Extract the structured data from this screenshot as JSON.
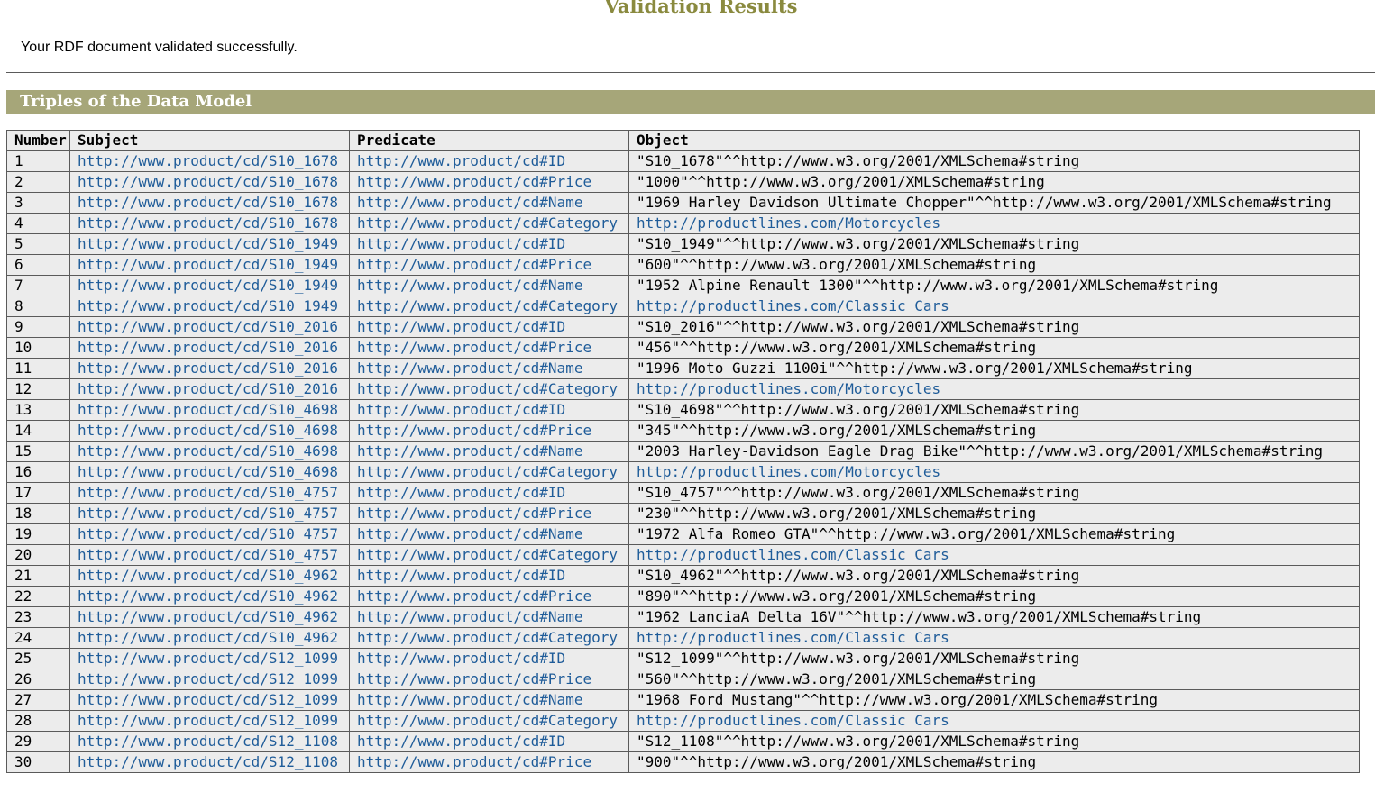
{
  "page": {
    "title": "Validation Results",
    "status_message": "Your RDF document validated successfully."
  },
  "section": {
    "title": "Triples of the Data Model"
  },
  "table": {
    "headers": {
      "number": "Number",
      "subject": "Subject",
      "predicate": "Predicate",
      "object": "Object"
    },
    "rows": [
      {
        "number": "1",
        "subject": "http://www.product/cd/S10_1678",
        "predicate": "http://www.product/cd#ID",
        "object": "\"S10_1678\"^^http://www.w3.org/2001/XMLSchema#string",
        "object_is_link": false
      },
      {
        "number": "2",
        "subject": "http://www.product/cd/S10_1678",
        "predicate": "http://www.product/cd#Price",
        "object": "\"1000\"^^http://www.w3.org/2001/XMLSchema#string",
        "object_is_link": false
      },
      {
        "number": "3",
        "subject": "http://www.product/cd/S10_1678",
        "predicate": "http://www.product/cd#Name",
        "object": "\"1969 Harley Davidson Ultimate Chopper\"^^http://www.w3.org/2001/XMLSchema#string",
        "object_is_link": false
      },
      {
        "number": "4",
        "subject": "http://www.product/cd/S10_1678",
        "predicate": "http://www.product/cd#Category",
        "object": "http://productlines.com/Motorcycles",
        "object_is_link": true
      },
      {
        "number": "5",
        "subject": "http://www.product/cd/S10_1949",
        "predicate": "http://www.product/cd#ID",
        "object": "\"S10_1949\"^^http://www.w3.org/2001/XMLSchema#string",
        "object_is_link": false
      },
      {
        "number": "6",
        "subject": "http://www.product/cd/S10_1949",
        "predicate": "http://www.product/cd#Price",
        "object": "\"600\"^^http://www.w3.org/2001/XMLSchema#string",
        "object_is_link": false
      },
      {
        "number": "7",
        "subject": "http://www.product/cd/S10_1949",
        "predicate": "http://www.product/cd#Name",
        "object": "\"1952 Alpine Renault 1300\"^^http://www.w3.org/2001/XMLSchema#string",
        "object_is_link": false
      },
      {
        "number": "8",
        "subject": "http://www.product/cd/S10_1949",
        "predicate": "http://www.product/cd#Category",
        "object": "http://productlines.com/Classic Cars",
        "object_is_link": true
      },
      {
        "number": "9",
        "subject": "http://www.product/cd/S10_2016",
        "predicate": "http://www.product/cd#ID",
        "object": "\"S10_2016\"^^http://www.w3.org/2001/XMLSchema#string",
        "object_is_link": false
      },
      {
        "number": "10",
        "subject": "http://www.product/cd/S10_2016",
        "predicate": "http://www.product/cd#Price",
        "object": "\"456\"^^http://www.w3.org/2001/XMLSchema#string",
        "object_is_link": false
      },
      {
        "number": "11",
        "subject": "http://www.product/cd/S10_2016",
        "predicate": "http://www.product/cd#Name",
        "object": "\"1996 Moto Guzzi 1100i\"^^http://www.w3.org/2001/XMLSchema#string",
        "object_is_link": false
      },
      {
        "number": "12",
        "subject": "http://www.product/cd/S10_2016",
        "predicate": "http://www.product/cd#Category",
        "object": "http://productlines.com/Motorcycles",
        "object_is_link": true
      },
      {
        "number": "13",
        "subject": "http://www.product/cd/S10_4698",
        "predicate": "http://www.product/cd#ID",
        "object": "\"S10_4698\"^^http://www.w3.org/2001/XMLSchema#string",
        "object_is_link": false
      },
      {
        "number": "14",
        "subject": "http://www.product/cd/S10_4698",
        "predicate": "http://www.product/cd#Price",
        "object": "\"345\"^^http://www.w3.org/2001/XMLSchema#string",
        "object_is_link": false
      },
      {
        "number": "15",
        "subject": "http://www.product/cd/S10_4698",
        "predicate": "http://www.product/cd#Name",
        "object": "\"2003 Harley-Davidson Eagle Drag Bike\"^^http://www.w3.org/2001/XMLSchema#string",
        "object_is_link": false
      },
      {
        "number": "16",
        "subject": "http://www.product/cd/S10_4698",
        "predicate": "http://www.product/cd#Category",
        "object": "http://productlines.com/Motorcycles",
        "object_is_link": true
      },
      {
        "number": "17",
        "subject": "http://www.product/cd/S10_4757",
        "predicate": "http://www.product/cd#ID",
        "object": "\"S10_4757\"^^http://www.w3.org/2001/XMLSchema#string",
        "object_is_link": false
      },
      {
        "number": "18",
        "subject": "http://www.product/cd/S10_4757",
        "predicate": "http://www.product/cd#Price",
        "object": "\"230\"^^http://www.w3.org/2001/XMLSchema#string",
        "object_is_link": false
      },
      {
        "number": "19",
        "subject": "http://www.product/cd/S10_4757",
        "predicate": "http://www.product/cd#Name",
        "object": "\"1972 Alfa Romeo GTA\"^^http://www.w3.org/2001/XMLSchema#string",
        "object_is_link": false
      },
      {
        "number": "20",
        "subject": "http://www.product/cd/S10_4757",
        "predicate": "http://www.product/cd#Category",
        "object": "http://productlines.com/Classic Cars",
        "object_is_link": true
      },
      {
        "number": "21",
        "subject": "http://www.product/cd/S10_4962",
        "predicate": "http://www.product/cd#ID",
        "object": "\"S10_4962\"^^http://www.w3.org/2001/XMLSchema#string",
        "object_is_link": false
      },
      {
        "number": "22",
        "subject": "http://www.product/cd/S10_4962",
        "predicate": "http://www.product/cd#Price",
        "object": "\"890\"^^http://www.w3.org/2001/XMLSchema#string",
        "object_is_link": false
      },
      {
        "number": "23",
        "subject": "http://www.product/cd/S10_4962",
        "predicate": "http://www.product/cd#Name",
        "object": "\"1962 LanciaA Delta 16V\"^^http://www.w3.org/2001/XMLSchema#string",
        "object_is_link": false
      },
      {
        "number": "24",
        "subject": "http://www.product/cd/S10_4962",
        "predicate": "http://www.product/cd#Category",
        "object": "http://productlines.com/Classic Cars",
        "object_is_link": true
      },
      {
        "number": "25",
        "subject": "http://www.product/cd/S12_1099",
        "predicate": "http://www.product/cd#ID",
        "object": "\"S12_1099\"^^http://www.w3.org/2001/XMLSchema#string",
        "object_is_link": false
      },
      {
        "number": "26",
        "subject": "http://www.product/cd/S12_1099",
        "predicate": "http://www.product/cd#Price",
        "object": "\"560\"^^http://www.w3.org/2001/XMLSchema#string",
        "object_is_link": false
      },
      {
        "number": "27",
        "subject": "http://www.product/cd/S12_1099",
        "predicate": "http://www.product/cd#Name",
        "object": "\"1968 Ford Mustang\"^^http://www.w3.org/2001/XMLSchema#string",
        "object_is_link": false
      },
      {
        "number": "28",
        "subject": "http://www.product/cd/S12_1099",
        "predicate": "http://www.product/cd#Category",
        "object": "http://productlines.com/Classic Cars",
        "object_is_link": true
      },
      {
        "number": "29",
        "subject": "http://www.product/cd/S12_1108",
        "predicate": "http://www.product/cd#ID",
        "object": "\"S12_1108\"^^http://www.w3.org/2001/XMLSchema#string",
        "object_is_link": false
      },
      {
        "number": "30",
        "subject": "http://www.product/cd/S12_1108",
        "predicate": "http://www.product/cd#Price",
        "object": "\"900\"^^http://www.w3.org/2001/XMLSchema#string",
        "object_is_link": false
      }
    ]
  },
  "colors": {
    "title": "#8a8a3f",
    "section_bg": "#a6a679",
    "link": "#1f5c99",
    "table_bg": "#ececec"
  }
}
